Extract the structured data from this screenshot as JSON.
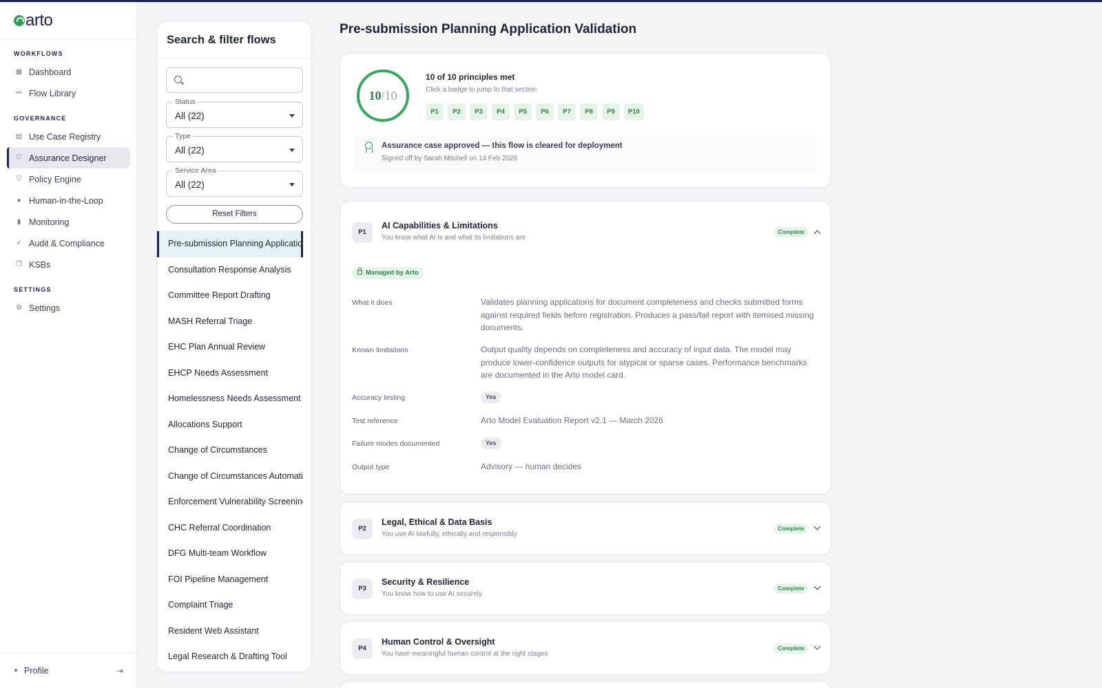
{
  "app": {
    "logo": "arto"
  },
  "sidebar": {
    "sections": [
      {
        "title": "WORKFLOWS",
        "items": [
          {
            "label": "Dashboard",
            "icon": "grid-icon"
          },
          {
            "label": "Flow Library",
            "icon": "flow-icon"
          }
        ]
      },
      {
        "title": "GOVERNANCE",
        "items": [
          {
            "label": "Use Case Registry",
            "icon": "registry-icon"
          },
          {
            "label": "Assurance Designer",
            "icon": "shield-check-icon",
            "active": true
          },
          {
            "label": "Policy Engine",
            "icon": "shield-icon"
          },
          {
            "label": "Human-in-the-Loop",
            "icon": "person-icon"
          },
          {
            "label": "Monitoring",
            "icon": "bar-chart-icon"
          },
          {
            "label": "Audit & Compliance",
            "icon": "check-circle-icon"
          },
          {
            "label": "KSBs",
            "icon": "stack-icon"
          }
        ]
      },
      {
        "title": "SETTINGS",
        "items": [
          {
            "label": "Settings",
            "icon": "gear-icon"
          }
        ]
      }
    ],
    "profile": "Profile"
  },
  "filter": {
    "title": "Search & filter flows",
    "search_placeholder": "",
    "status": {
      "label": "Status",
      "value": "All (22)"
    },
    "type": {
      "label": "Type",
      "value": "All (22)"
    },
    "service_area": {
      "label": "Service Area",
      "value": "All (22)"
    },
    "reset_label": "Reset Filters",
    "flows": [
      "Pre-submission Planning Application Validation",
      "Consultation Response Analysis",
      "Committee Report Drafting",
      "MASH Referral Triage",
      "EHC Plan Annual Review",
      "EHCP Needs Assessment",
      "Homelessness Needs Assessment",
      "Allocations Support",
      "Change of Circumstances",
      "Change of Circumstances Automation",
      "Enforcement Vulnerability Screening",
      "CHC Referral Coordination",
      "DFG Multi-team Workflow",
      "FOI Pipeline Management",
      "Complaint Triage",
      "Resident Web Assistant",
      "Legal Research & Drafting Tool"
    ]
  },
  "main": {
    "title": "Pre-submission Planning Application Validation",
    "summary": {
      "score_num": "10",
      "score_den": "/10",
      "principles_met": "10 of 10 principles met",
      "hint": "Click a badge to jump to that section",
      "badges": [
        "P1",
        "P2",
        "P3",
        "P4",
        "P5",
        "P6",
        "P7",
        "P8",
        "P9",
        "P10"
      ],
      "approved_title": "Assurance case approved — this flow is cleared for deployment",
      "approved_sub": "Signed off by Sarah Mitchell on 14 Feb 2026"
    },
    "principles": [
      {
        "num": "P1",
        "title": "AI Capabilities & Limitations",
        "sub": "You know what AI is and what its limitations are",
        "status": "Complete",
        "managed": "Managed by Arto",
        "rows": [
          {
            "label": "What it does",
            "value": "Validates planning applications for document completeness and checks submitted forms against required fields before registration. Produces a pass/fail report with itemised missing documents."
          },
          {
            "label": "Known limitations",
            "value": "Output quality depends on completeness and accuracy of input data. The model may produce lower-confidence outputs for atypical or sparse cases. Performance benchmarks are documented in the Arto model card."
          },
          {
            "label": "Accuracy testing",
            "value": "Yes"
          },
          {
            "label": "Test reference",
            "value": "Arto Model Evaluation Report v2.1 — March 2026"
          },
          {
            "label": "Failure modes documented",
            "value": "Yes"
          },
          {
            "label": "Output type",
            "value": "Advisory — human decides"
          }
        ]
      },
      {
        "num": "P2",
        "title": "Legal, Ethical & Data Basis",
        "sub": "You use AI lawfully, ethically and responsibly",
        "status": "Complete"
      },
      {
        "num": "P3",
        "title": "Security & Resilience",
        "sub": "You know how to use AI securely",
        "status": "Complete"
      },
      {
        "num": "P4",
        "title": "Human Control & Oversight",
        "sub": "You have meaningful human control at the right stages",
        "status": "Complete"
      }
    ]
  }
}
